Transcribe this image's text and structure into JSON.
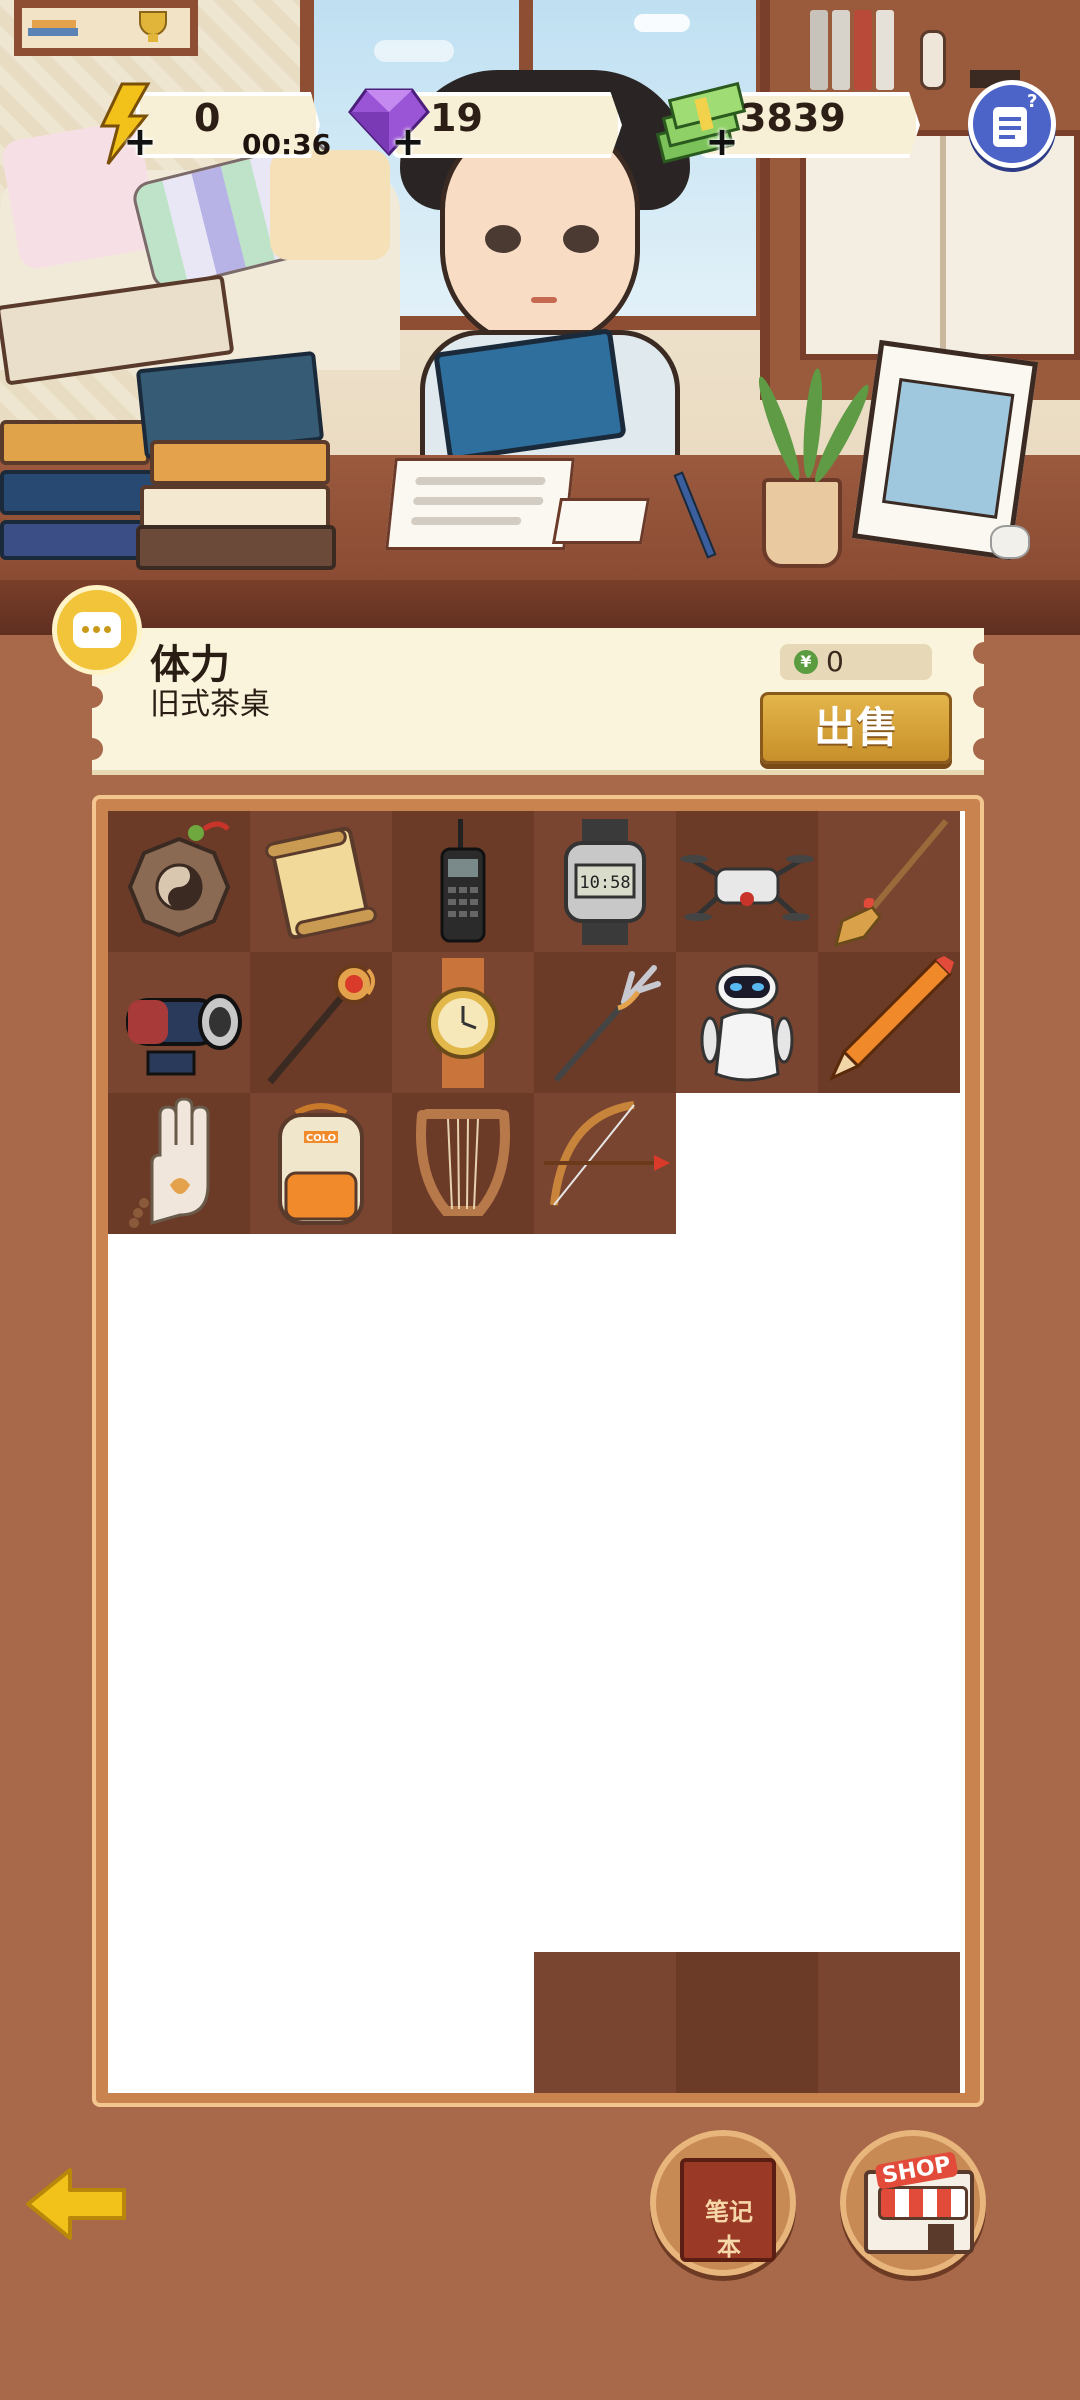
{
  "hud": {
    "energy": {
      "value": "0",
      "timer": "00:36",
      "icon": "lightning-icon",
      "add_icon": "plus-icon"
    },
    "gems": {
      "value": "19",
      "icon": "purple-gem-icon",
      "add_icon": "plus-icon"
    },
    "cash": {
      "value": "3839",
      "icon": "cash-stack-icon",
      "add_icon": "plus-icon"
    },
    "menu_icon": "task-list-icon"
  },
  "item_info": {
    "title": "体力",
    "subtitle": "旧式茶桌",
    "price": "0",
    "currency_icon": "yen-coin-icon",
    "sell_label": "出售"
  },
  "inventory": {
    "items": [
      {
        "name": "bagua-mirror-icon"
      },
      {
        "name": "scroll-icon"
      },
      {
        "name": "brick-phone-icon"
      },
      {
        "name": "digital-watch-icon",
        "display": "10:58"
      },
      {
        "name": "drone-icon"
      },
      {
        "name": "broom-icon"
      },
      {
        "name": "cannon-icon"
      },
      {
        "name": "magic-staff-icon"
      },
      {
        "name": "gold-wristwatch-icon"
      },
      {
        "name": "trident-icon"
      },
      {
        "name": "white-robot-icon"
      },
      {
        "name": "pencil-icon"
      },
      {
        "name": "buddha-hand-icon"
      },
      {
        "name": "backpack-icon",
        "tag": "COLO"
      },
      {
        "name": "lyre-icon"
      },
      {
        "name": "bow-and-arrow-icon"
      }
    ]
  },
  "nav": {
    "back_icon": "back-arrow-icon",
    "notebook_label": "笔记本",
    "shop_label": "SHOP"
  },
  "colors": {
    "background": "#a8684a",
    "cell_dark": "#6c3b28",
    "sell_button": "#d4a23a",
    "menu_button": "#4c63c8"
  }
}
